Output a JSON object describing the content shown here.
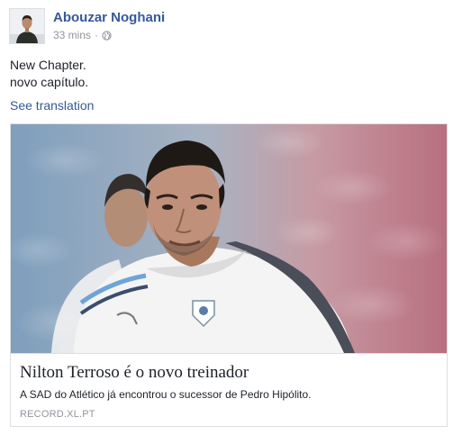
{
  "post": {
    "author": "Abouzar Noghani",
    "timestamp": "33 mins",
    "separator": "·",
    "privacy_icon": "globe-icon",
    "lines": [
      "New Chapter.",
      "novo capítulo."
    ],
    "see_translation": "See translation"
  },
  "link_preview": {
    "image_subject": "photo",
    "title": "Nilton Terroso é o novo treinador",
    "description": "A SAD do Atlético já encontrou o sucessor de Pedro Hipólito.",
    "domain": "RECORD.XL.PT"
  },
  "colors": {
    "link_blue": "#365899",
    "meta_gray": "#90949c",
    "text_dark": "#1d2129",
    "border": "#dddfe2"
  }
}
